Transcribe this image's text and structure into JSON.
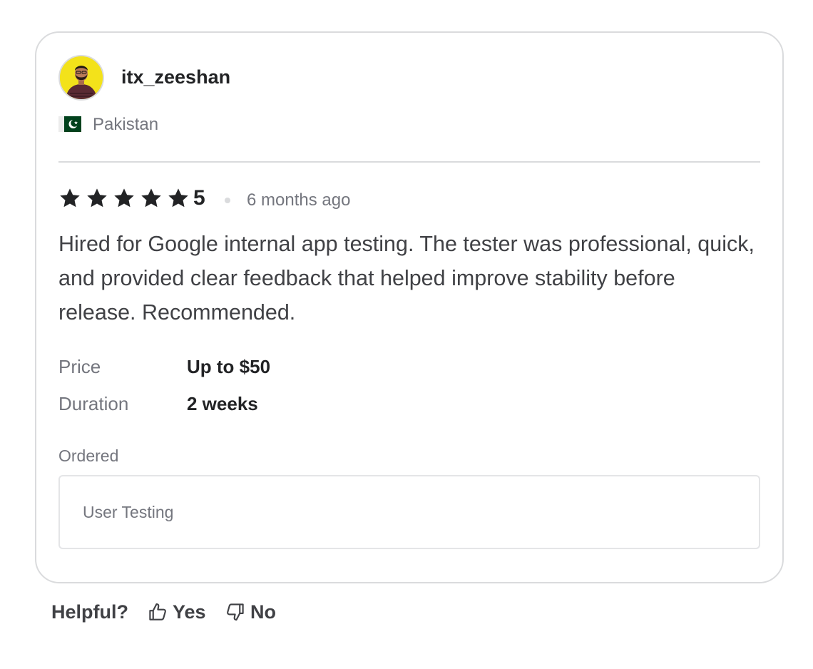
{
  "review": {
    "username": "itx_zeeshan",
    "country": "Pakistan",
    "rating": "5",
    "stars_filled": 5,
    "time_ago": "6 months ago",
    "text": "Hired for Google internal app testing. The tester was professional, quick, and provided clear feedback that helped improve stability before release. Recommended.",
    "price_label": "Price",
    "price_value": "Up to $50",
    "duration_label": "Duration",
    "duration_value": "2 weeks",
    "ordered_label": "Ordered",
    "ordered_item": "User Testing"
  },
  "helpful": {
    "label": "Helpful?",
    "yes_label": "Yes",
    "no_label": "No"
  },
  "colors": {
    "text_dark": "#222325",
    "text_muted": "#74767e",
    "border": "#dadbdd",
    "avatar_bg": "#f3e21a",
    "flag_green": "#01411c"
  },
  "icons": {
    "avatar": "user-avatar-photo",
    "flag": "pakistan-flag-icon",
    "star": "star-icon",
    "yes": "thumbs-up-icon",
    "no": "thumbs-down-icon"
  }
}
